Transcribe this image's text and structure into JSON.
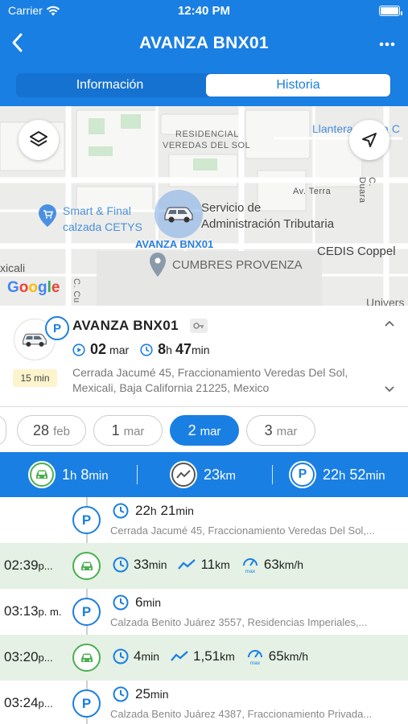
{
  "status_bar": {
    "carrier": "Carrier",
    "time": "12:40 PM"
  },
  "nav": {
    "title": "AVANZA BNX01"
  },
  "tabs": [
    {
      "label": "Información"
    },
    {
      "label": "Historia"
    }
  ],
  "map": {
    "labels": {
      "residencial_1": "RESIDENCIAL",
      "residencial_2": "VEREDAS DEL SOL",
      "llantera": "Llantera Nueva C",
      "av_terra": "Av. Terra",
      "c_duara": "C. Duara",
      "smart_final_1": "Smart & Final",
      "smart_final_2": "calzada CETYS",
      "sat_1": "Servicio de",
      "sat_2": "Administración Tributaria",
      "cedis": "CEDIS Coppel",
      "cumbres": "CUMBRES PROVENZA",
      "mexicali": "xicali",
      "c_cu": "C. Cu",
      "universidad": "Univers",
      "google": "Google"
    },
    "vehicle_label": "AVANZA BNX01"
  },
  "card": {
    "title": "AVANZA BNX01",
    "date_day": "02",
    "date_month": "mar",
    "duration_hours": "8",
    "duration_hours_unit": "h",
    "duration_minutes": "47",
    "duration_minutes_unit": "min",
    "badge": "15 min",
    "address": "Cerrada Jacumé 45, Fraccionamiento Veredas Del Sol, Mexicali, Baja California 21225, Mexico"
  },
  "dates": [
    {
      "day": "28",
      "month": "feb"
    },
    {
      "day": "1",
      "month": "mar"
    },
    {
      "day": "2",
      "month": "mar",
      "active": true
    },
    {
      "day": "3",
      "month": "mar"
    }
  ],
  "summary": {
    "driving": {
      "h": "1",
      "hu": "h",
      "m": "8",
      "mu": "min"
    },
    "distance": {
      "v": "23",
      "u": "km"
    },
    "parked": {
      "h": "22",
      "hu": "h",
      "m": "52",
      "mu": "min"
    }
  },
  "timeline": [
    {
      "type": "park",
      "time": "",
      "ampm": "",
      "h": "22",
      "hu": "h",
      "m": "21",
      "mu": "min",
      "address": "Cerrada Jacumé 45, Fraccionamiento Veredas Del Sol,..."
    },
    {
      "type": "trip",
      "time": "02:39",
      "ampm": "p...",
      "duration": "33",
      "duration_unit": "min",
      "distance": "11",
      "distance_unit": "km",
      "speed": "63",
      "speed_unit": "km/h"
    },
    {
      "type": "park",
      "time": "03:13",
      "ampm": "p. m.",
      "m": "6",
      "mu": "min",
      "address": "Calzada Benito Juárez 3557, Residencias Imperiales,..."
    },
    {
      "type": "trip",
      "time": "03:20",
      "ampm": "p...",
      "duration": "4",
      "duration_unit": "min",
      "distance": "1,51",
      "distance_unit": "km",
      "speed": "65",
      "speed_unit": "km/h"
    },
    {
      "type": "park",
      "time": "03:24",
      "ampm": "p...",
      "m": "25",
      "mu": "min",
      "address": "Calzada Benito Juárez 4387, Fraccionamiento Privada..."
    }
  ],
  "colors": {
    "primary": "#1a7fe3",
    "trip_row": "#e4f1e4",
    "car_green": "#4caf50"
  }
}
